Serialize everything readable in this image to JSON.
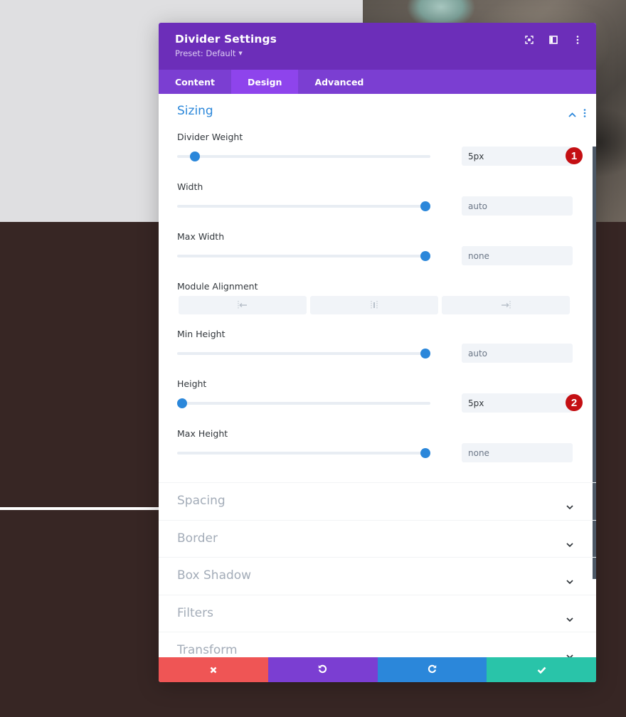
{
  "modal": {
    "title": "Divider Settings",
    "preset_label": "Preset: Default",
    "header_icons": [
      "focus-mode-icon",
      "split-view-icon",
      "more-options-icon"
    ]
  },
  "tabs": [
    {
      "label": "Content",
      "active": false
    },
    {
      "label": "Design",
      "active": true
    },
    {
      "label": "Advanced",
      "active": false
    }
  ],
  "sections": {
    "sizing": {
      "title": "Sizing",
      "expanded": true,
      "fields": {
        "divider_weight": {
          "label": "Divider Weight",
          "value": "5px",
          "slider_fraction": 0.07,
          "badge": "1"
        },
        "width": {
          "label": "Width",
          "placeholder": "auto",
          "slider_fraction": 0.98
        },
        "max_width": {
          "label": "Max Width",
          "placeholder": "none",
          "slider_fraction": 0.98
        },
        "module_alignment": {
          "label": "Module Alignment",
          "options": [
            "left",
            "center",
            "right"
          ]
        },
        "min_height": {
          "label": "Min Height",
          "placeholder": "auto",
          "slider_fraction": 0.98
        },
        "height": {
          "label": "Height",
          "value": "5px",
          "slider_fraction": 0.02,
          "badge": "2"
        },
        "max_height": {
          "label": "Max Height",
          "placeholder": "none",
          "slider_fraction": 0.98
        }
      }
    },
    "collapsed": [
      {
        "title": "Spacing"
      },
      {
        "title": "Border"
      },
      {
        "title": "Box Shadow"
      },
      {
        "title": "Filters"
      },
      {
        "title": "Transform"
      }
    ]
  },
  "footer": {
    "buttons": [
      {
        "name": "cancel",
        "icon": "close-icon",
        "color": "#ef5555"
      },
      {
        "name": "undo",
        "icon": "undo-icon",
        "color": "#7b3ed2"
      },
      {
        "name": "redo",
        "icon": "redo-icon",
        "color": "#2b87da"
      },
      {
        "name": "save",
        "icon": "check-icon",
        "color": "#29c4a9"
      }
    ]
  },
  "colors": {
    "header": "#6c2eb9",
    "tabs": "#7b3ed2",
    "active_tab": "#8e44ec",
    "accent": "#2b87da",
    "badge": "#c40f13"
  }
}
